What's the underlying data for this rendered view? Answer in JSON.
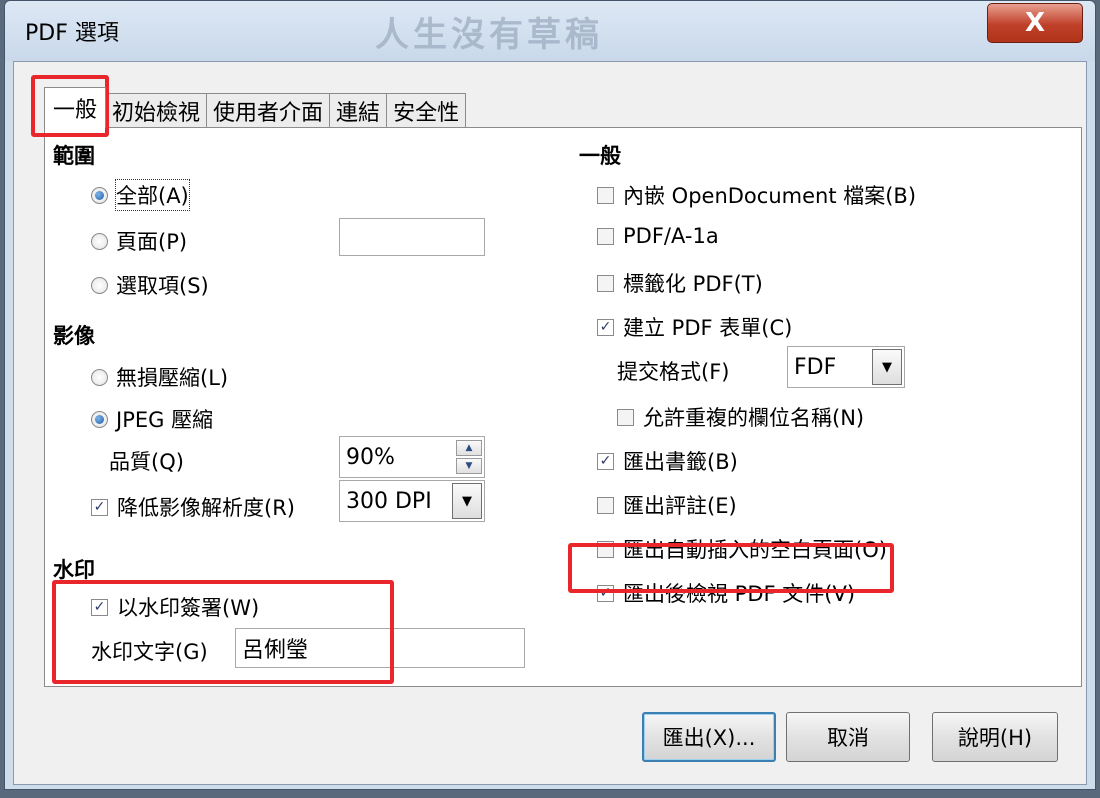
{
  "window": {
    "title": "PDF 選項",
    "watermark_text": "人生沒有草稿",
    "close_label": "X"
  },
  "tabs": [
    {
      "label": "一般"
    },
    {
      "label": "初始檢視"
    },
    {
      "label": "使用者介面"
    },
    {
      "label": "連結"
    },
    {
      "label": "安全性"
    }
  ],
  "range": {
    "heading": "範圍",
    "all": "全部(A)",
    "pages": "頁面(P)",
    "selection": "選取項(S)",
    "pages_value": ""
  },
  "images": {
    "heading": "影像",
    "lossless": "無損壓縮(L)",
    "jpeg": "JPEG 壓縮",
    "quality_label": "品質(Q)",
    "quality_value": "90%",
    "reduce_label": "降低影像解析度(R)",
    "reduce_value": "300 DPI"
  },
  "watermark": {
    "heading": "水印",
    "sign_label": "以水印簽署(W)",
    "text_label": "水印文字(G)",
    "text_value": "呂俐瑩"
  },
  "general": {
    "heading": "一般",
    "embed_odf": "內嵌 OpenDocument 檔案(B)",
    "pdfa": "PDF/A-1a",
    "tagged": "標籤化 PDF(T)",
    "forms": "建立 PDF 表單(C)",
    "submit_label": "提交格式(F)",
    "submit_value": "FDF",
    "dup_names": "允許重複的欄位名稱(N)",
    "bookmarks": "匯出書籤(B)",
    "comments": "匯出評註(E)",
    "blank_pages": "匯出自動插入的空白頁面(O)",
    "view_after": "匯出後檢視 PDF 文件(V)"
  },
  "buttons": {
    "export": "匯出(X)...",
    "cancel": "取消",
    "help": "說明(H)"
  },
  "colors": {
    "highlight": "#e8262b",
    "accent": "#1d5fa8"
  }
}
